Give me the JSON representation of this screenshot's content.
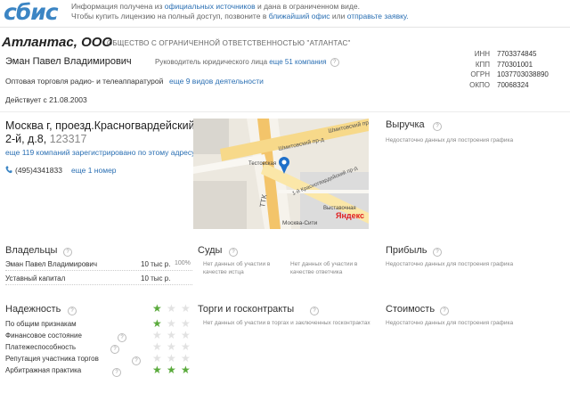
{
  "header": {
    "logo": "сбис",
    "notice_line1_a": "Информация получена из",
    "notice_line1_link": "официальных источников",
    "notice_line1_b": "и дана в ограниченном виде.",
    "notice_line2_a": "Чтобы купить лицензию на полный доступ, позвоните в",
    "notice_line2_link1": "ближайший офис",
    "notice_line2_b": "или",
    "notice_line2_link2": "отправьте заявку."
  },
  "company": {
    "short_name": "Атлантас, ООО",
    "full_name": "ОБЩЕСТВО С ОГРАНИЧЕННОЙ ОТВЕТСТВЕННОСТЬЮ \"АТЛАНТАС\"",
    "director": "Эман Павел Владимирович",
    "director_role": "Руководитель юридического лица",
    "director_more": "еще 51 компания",
    "activity": "Оптовая торговля радио- и телеаппаратурой",
    "activity_more": "еще 9 видов деятельности",
    "since": "Действует с 21.08.2003"
  },
  "requisites": [
    {
      "label": "ИНН",
      "value": "7703374845"
    },
    {
      "label": "КПП",
      "value": "770301001"
    },
    {
      "label": "ОГРН",
      "value": "1037703038890"
    },
    {
      "label": "ОКПО",
      "value": "70068324"
    }
  ],
  "contacts": {
    "address_line1": "Москва г, проезд.Красногвардейский",
    "address_line2": "2-й, д.8,",
    "zip": "123317",
    "address_more": "еще 119 компаний зарегистрировано по этому адресу",
    "phone": "(495)4341833",
    "phone_more": "еще 1 номер"
  },
  "map": {
    "labels": {
      "street1": "Шмитовский пр-д",
      "street2": "Шмитовский пр-д",
      "street3": "1-й Красногвардейский пр-д",
      "station": "Тестовская",
      "ttk": "ТТК",
      "exhibition": "Выставочная",
      "moscow_city": "Москва-Сити",
      "yandex": "Яндекс"
    }
  },
  "finance": {
    "revenue_title": "Выручка",
    "revenue_note": "Недостаточно данных для построения графика",
    "profit_title": "Прибыль",
    "profit_note": "Недостаточно данных для построения графика",
    "value_title": "Стоимость",
    "value_note": "Недостаточно данных для построения графика"
  },
  "owners": {
    "title": "Владельцы",
    "rows": [
      {
        "name": "Эман Павел Владимирович",
        "amount": "10 тыс р.",
        "share": "100%"
      },
      {
        "name": "Уставный капитал",
        "amount": "10 тыс р.",
        "share": ""
      }
    ]
  },
  "courts": {
    "title": "Суды",
    "note_plaintiff": "Нет данных об участии в качестве истца",
    "note_defendant": "Нет данных об участии в качестве ответчика"
  },
  "tenders": {
    "title": "Торги и госконтракты",
    "note": "Нет данных об участии в торгах и заключенных госконтрактах"
  },
  "reliability": {
    "title": "Надежность",
    "rows": [
      {
        "label": "По общим признакам",
        "stars": 1
      },
      {
        "label": "Финансовое состояние",
        "stars": 0
      },
      {
        "label": "Платежеспособность",
        "stars": 0
      },
      {
        "label": "Репутация участника торгов",
        "stars": 0
      },
      {
        "label": "Арбитражная практика",
        "stars": 3
      }
    ],
    "overall_stars": 1
  },
  "colors": {
    "accent": "#2a6fb3",
    "logo": "#3b85c4",
    "star_on": "#5aaa3c",
    "star_off": "#e2e2e2"
  }
}
